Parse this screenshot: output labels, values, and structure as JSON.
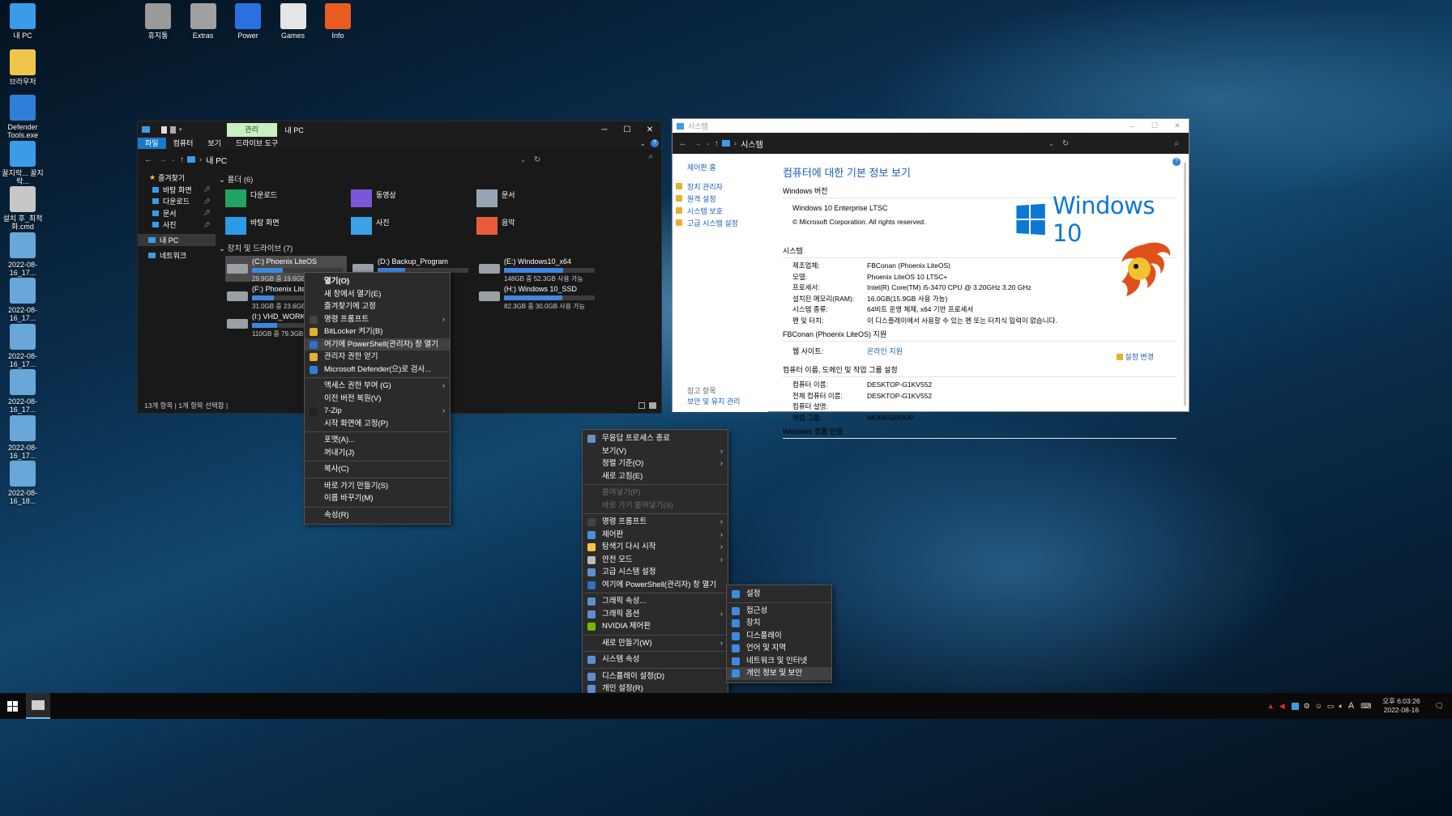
{
  "desktop": {
    "icons": [
      {
        "label": "내 PC",
        "color": "#3a9be8"
      },
      {
        "label": "브라우저",
        "color": "#f0c64a"
      },
      {
        "label": "Defender Tools.exe",
        "color": "#2f7fd8"
      },
      {
        "label": "꿀지락... 꿀지락...",
        "color": "#3c9ae8"
      },
      {
        "label": "설치 후_최적화.cmd",
        "color": "#c7c7c7"
      },
      {
        "label": "2022-08-16_17...",
        "color": "#6aa7d9"
      },
      {
        "label": "2022-08-16_17...",
        "color": "#6aa7d9"
      },
      {
        "label": "2022-08-16_17...",
        "color": "#6aa7d9"
      },
      {
        "label": "2022-08-16_17...",
        "color": "#6aa7d9"
      },
      {
        "label": "2022-08-16_17...",
        "color": "#6aa7d9"
      },
      {
        "label": "2022-08-16_18...",
        "color": "#6aa7d9"
      }
    ],
    "top_icons": [
      {
        "label": "휴지통",
        "color": "#9a9a9a"
      },
      {
        "label": "Extras",
        "color": "#a0a0a0"
      },
      {
        "label": "Power",
        "color": "#2c6fe0"
      },
      {
        "label": "Games",
        "color": "#e5e5e5"
      },
      {
        "label": "Info",
        "color": "#e85c1f"
      }
    ]
  },
  "explorer": {
    "ribbon_manage": "관리",
    "title": "내 PC",
    "tabs": [
      "파일",
      "컴퓨터",
      "보기",
      "드라이브 도구"
    ],
    "address": "내 PC",
    "nav": {
      "quick": "즐겨찾기",
      "items": [
        "바탕 화면",
        "다운로드",
        "문서",
        "사진"
      ],
      "thispc": "내 PC",
      "network": "네트워크"
    },
    "folders_header": "폴더 (6)",
    "folders": [
      "다운로드",
      "동영상",
      "문서",
      "바탕 화면",
      "사진",
      "음악"
    ],
    "drives_header": "장치 및 드라이브 (7)",
    "drives": [
      {
        "name": "(C:) Phoenix LiteOS",
        "space": "29.9GB 중 19.6GB 사용 가능",
        "used": 0.34
      },
      {
        "name": "(D:) Backup_Program",
        "space": "",
        "used": 0.3
      },
      {
        "name": "(E:) Windows10_x64",
        "space": "148GB 중 52.3GB 사용 가능",
        "used": 0.65
      },
      {
        "name": "(F:) Phoenix LiteOS",
        "space": "31.0GB 중 23.6GB 사용 가능",
        "used": 0.24
      },
      {
        "name": "(H:) Windows 10_SSD",
        "space": "82.3GB 중 30.0GB 사용 가능",
        "used": 0.64
      },
      {
        "name": "(I:) VHD_WORK",
        "space": "110GB 중 79.3GB 사용 가능",
        "used": 0.28
      }
    ],
    "status": "13개 항목  |  1개 항목 선택함  |"
  },
  "ctx1": [
    {
      "label": "열기(O)",
      "bold": true
    },
    {
      "label": "새 창에서 열기(E)"
    },
    {
      "label": "즐겨찾기에 고정"
    },
    {
      "label": "명령 프롬프트",
      "arrow": true,
      "icon": "#444"
    },
    {
      "label": "BitLocker 켜기(B)",
      "icon": "#e3b12c"
    },
    {
      "label": "여기에 PowerShell(관리자) 창 열기",
      "icon": "#2f6fc8",
      "hl": true
    },
    {
      "label": "관리자 권한 얻기",
      "icon": "#e3b12c"
    },
    {
      "label": "Microsoft Defender(으)로 검사...",
      "icon": "#2f7fd8"
    },
    {
      "sep": true
    },
    {
      "label": "액세스 권한 부여 (G)",
      "arrow": true
    },
    {
      "label": "이전 버전 복원(V)"
    },
    {
      "label": "7-Zip",
      "arrow": true,
      "icon": "#222"
    },
    {
      "label": "시작 화면에 고정(P)"
    },
    {
      "sep": true
    },
    {
      "label": "포맷(A)..."
    },
    {
      "label": "꺼내기(J)"
    },
    {
      "sep": true
    },
    {
      "label": "복사(C)"
    },
    {
      "sep": true
    },
    {
      "label": "바로 가기 만들기(S)"
    },
    {
      "label": "이름 바꾸기(M)"
    },
    {
      "sep": true
    },
    {
      "label": "속성(R)"
    }
  ],
  "ctx2": [
    {
      "label": "무응답 프로세스 종료",
      "icon": "#6a8fc0"
    },
    {
      "label": "보기(V)",
      "arrow": true
    },
    {
      "label": "정렬 기준(O)",
      "arrow": true
    },
    {
      "label": "새로 고침(E)"
    },
    {
      "sep": true
    },
    {
      "label": "붙여넣기(P)",
      "dis": true
    },
    {
      "label": "바로 가기 붙여넣기(S)",
      "dis": true
    },
    {
      "sep": true
    },
    {
      "label": "명령 프롬프트",
      "arrow": true,
      "icon": "#444"
    },
    {
      "label": "제어판",
      "arrow": true,
      "icon": "#4a8fe0"
    },
    {
      "label": "탐색기 다시 시작",
      "arrow": true,
      "icon": "#f0c64a"
    },
    {
      "label": "안전 모드",
      "arrow": true,
      "icon": "#bbb"
    },
    {
      "label": "고급 시스템 설정",
      "icon": "#5b8fd0"
    },
    {
      "label": "여기에 PowerShell(관리자) 창 열기",
      "icon": "#2f6fc8"
    },
    {
      "sep": true
    },
    {
      "label": "그래픽 속성...",
      "icon": "#5b8fd0"
    },
    {
      "label": "그래픽 옵션",
      "arrow": true,
      "icon": "#5b8fd0"
    },
    {
      "label": "NVIDIA 제어판",
      "icon": "#76b900"
    },
    {
      "sep": true
    },
    {
      "label": "새로 만들기(W)",
      "arrow": true
    },
    {
      "sep": true
    },
    {
      "label": "시스템 속성",
      "icon": "#5b8fd0"
    },
    {
      "sep": true
    },
    {
      "label": "디스플레이 설정(D)",
      "icon": "#5b8fd0"
    },
    {
      "label": "개인 설정(R)",
      "icon": "#5b8fd0"
    },
    {
      "label": "설정",
      "arrow": true,
      "icon": "#3c8be0",
      "hl": true
    }
  ],
  "ctx3": [
    {
      "label": "설정"
    },
    {
      "sep": true
    },
    {
      "label": "접근성"
    },
    {
      "label": "장치"
    },
    {
      "label": "디스플레이"
    },
    {
      "label": "언어 및 지역"
    },
    {
      "label": "네트워크 및 인터넷"
    },
    {
      "label": "개인 정보 및 보안",
      "hl": true
    }
  ],
  "system": {
    "title": "시스템",
    "address": "시스템",
    "side": {
      "home": "제어판 홈",
      "links": [
        "장치 관리자",
        "원격 설정",
        "시스템 보호",
        "고급 시스템 설정"
      ],
      "see_also": "참고 항목",
      "security": "보안 및 유지 관리"
    },
    "heading": "컴퓨터에 대한 기본 정보 보기",
    "edition_h": "Windows 버전",
    "edition": "Windows 10 Enterprise LTSC",
    "copyright": "© Microsoft Corporation. All rights reserved.",
    "logo_text": "Windows 10",
    "sys_h": "시스템",
    "rows": [
      [
        "제조업체:",
        "FBConan (Phoenix LiteOS)"
      ],
      [
        "모델:",
        "Phoenix LiteOS 10 LTSC+"
      ],
      [
        "프로세서:",
        "Intel(R) Core(TM) i5-3470 CPU @ 3.20GHz   3.20 GHz"
      ],
      [
        "설치된 메모리(RAM):",
        "16.0GB(15.9GB 사용 가능)"
      ],
      [
        "시스템 종류:",
        "64비트 운영 체제, x64 기반 프로세서"
      ],
      [
        "펜 및 터치:",
        "이 디스플레이에서 사용할 수 있는 펜 또는 터치식 입력이 없습니다."
      ]
    ],
    "support_h": "FBConan (Phoenix LiteOS) 지원",
    "website_l": "웹 사이트:",
    "website_v": "온라인 지원",
    "comp_h": "컴퓨터 이름, 도메인 및 작업 그룹 설정",
    "change": "설정 변경",
    "comp_rows": [
      [
        "컴퓨터 이름:",
        "DESKTOP-G1KV552"
      ],
      [
        "전체 컴퓨터 이름:",
        "DESKTOP-G1KV552"
      ],
      [
        "컴퓨터 설명:",
        ""
      ],
      [
        "작업 그룹:",
        "WORKGROUP"
      ]
    ],
    "activation_h": "Windows 정품 인증"
  },
  "taskbar": {
    "time": "오후 6:03:26",
    "date": "2022-08-16",
    "ime": "A"
  }
}
